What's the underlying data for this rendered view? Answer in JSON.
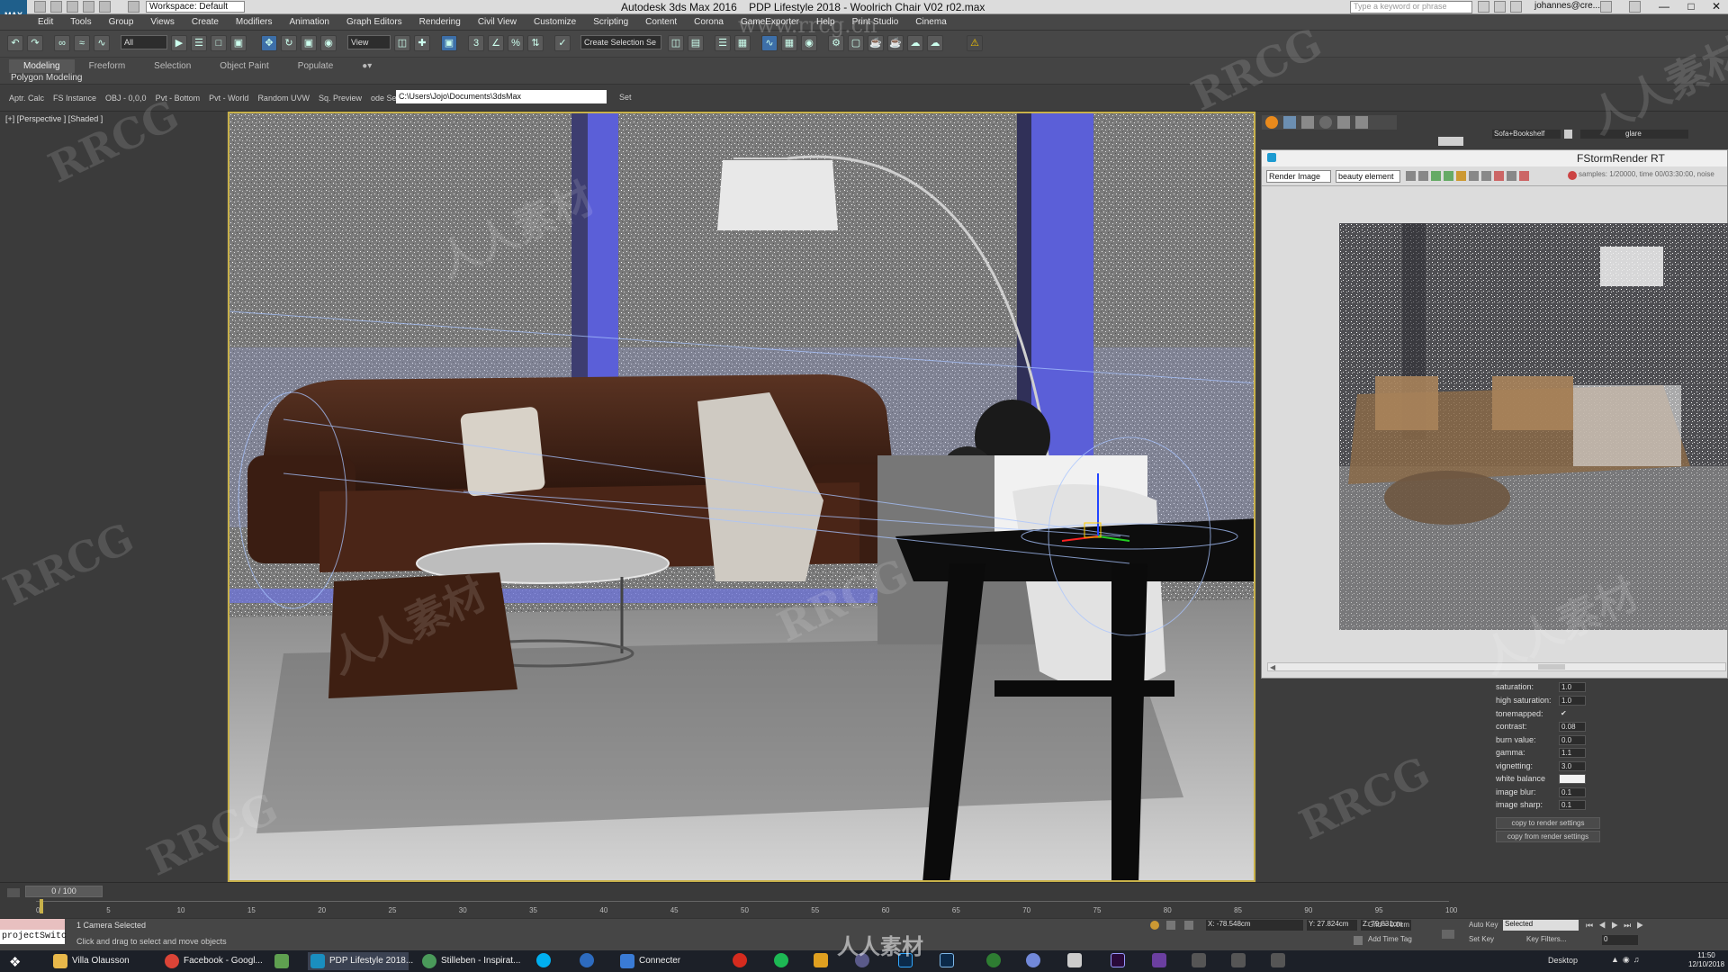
{
  "window": {
    "app_title": "Autodesk 3ds Max 2016",
    "file_title": "PDP Lifestyle 2018 - Woolrich Chair V02 r02.max",
    "workspace": "Workspace: Default",
    "search_placeholder": "Type a keyword or phrase",
    "user": "johannes@cre..."
  },
  "menu": [
    "Edit",
    "Tools",
    "Group",
    "Views",
    "Create",
    "Modifiers",
    "Animation",
    "Graph Editors",
    "Rendering",
    "Civil View",
    "Customize",
    "Scripting",
    "Content",
    "Corona",
    "GameExporter",
    "Help",
    "Print Studio",
    "Cinema"
  ],
  "toolbar": {
    "filter": "All",
    "view": "View",
    "selection_set": "Create Selection Se"
  },
  "ribbon": {
    "tabs": [
      "Modeling",
      "Freeform",
      "Selection",
      "Object Paint",
      "Populate"
    ],
    "sub_label": "Polygon Modeling"
  },
  "subtoolbar": {
    "items": [
      "Aptr. Calc",
      "FS Instance",
      "OBJ - 0,0,0",
      "Pvt - Bottom",
      "Pvt - World",
      "Random UVW",
      "Sq. Preview",
      "ode Selected '"
    ],
    "path": "C:\\Users\\Jojo\\Documents\\3dsMax",
    "set_label": "Set"
  },
  "viewport": {
    "label": "[+] [Perspective ] [Shaded ]"
  },
  "command_panel": {
    "object_name": "Sofa+Bookshelf",
    "layer": "glare"
  },
  "render_window": {
    "title": "FStormRender RT",
    "render_select": "Render Image",
    "element_select": "beauty element",
    "status": "samples: 1/20000,  time 00/03:30:00,  noise"
  },
  "render_settings": [
    {
      "label": "saturation:",
      "value": "1.0"
    },
    {
      "label": "high saturation:",
      "value": "1.0"
    },
    {
      "label": "tonemapped:",
      "value": "✔"
    },
    {
      "label": "contrast:",
      "value": "0.08"
    },
    {
      "label": "burn value:",
      "value": "0.0"
    },
    {
      "label": "gamma:",
      "value": "1.1"
    },
    {
      "label": "vignetting:",
      "value": "3.0"
    },
    {
      "label": "white balance",
      "value": ""
    },
    {
      "label": "image blur:",
      "value": "0.1"
    },
    {
      "label": "image sharp:",
      "value": "0.1"
    }
  ],
  "render_buttons": [
    "copy to render settings",
    "copy from render settings"
  ],
  "timeline": {
    "frame": "0 / 100",
    "ticks": [
      "0",
      "5",
      "10",
      "15",
      "20",
      "25",
      "30",
      "35",
      "40",
      "45",
      "50",
      "55",
      "60",
      "65",
      "70",
      "75",
      "80",
      "85",
      "90",
      "95",
      "100"
    ]
  },
  "status": {
    "maxscript": "projectSwitc",
    "selection": "1 Camera Selected",
    "prompt": "Click and drag to select and move objects",
    "x": "X: -78.548cm",
    "y": "Y: 27.824cm",
    "z": "Z: 79.831cm",
    "grid": "Grid = 0.0cm",
    "add_time_tag": "Add Time Tag",
    "auto_key": "Auto Key",
    "set_key": "Set Key",
    "selected": "Selected",
    "key_filters": "Key Filters..."
  },
  "taskbar": {
    "items": [
      "Villa Olausson",
      "Facebook - Googl...",
      "PDP Lifestyle 2018...",
      "Stilleben - Inspirat...",
      "Connecter"
    ],
    "desktop": "Desktop",
    "time": "11:50",
    "date": "12/10/2018"
  },
  "watermarks": [
    "RRCG",
    "人人素材",
    "www.rrcg.cn"
  ]
}
